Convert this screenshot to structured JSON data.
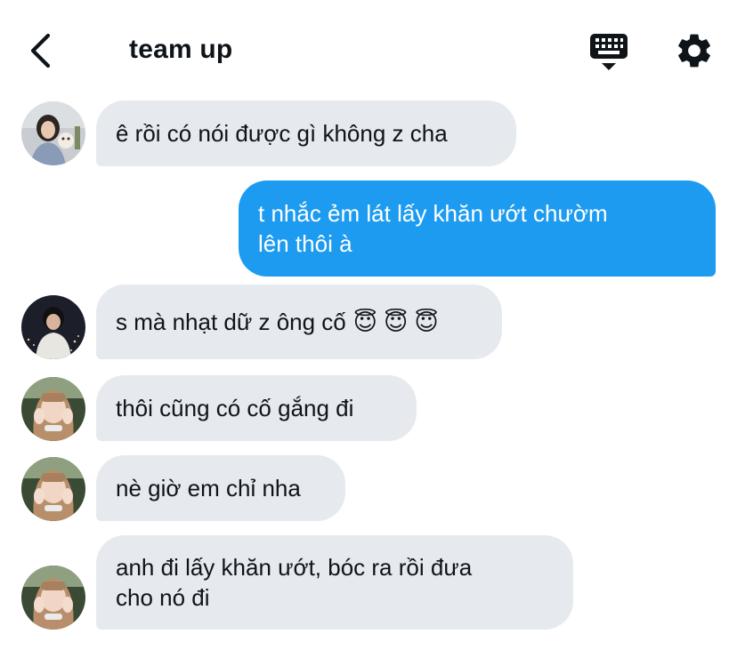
{
  "header": {
    "title": "team up",
    "back_icon": "chevron-left-icon",
    "keyboard_icon": "keyboard-icon",
    "settings_icon": "gear-icon"
  },
  "messages": [
    {
      "direction": "incoming",
      "avatar": "avatar-girl-with-dog",
      "text": "ê rồi có nói được gì không z cha"
    },
    {
      "direction": "outgoing",
      "text_line1": "t nhắc ẻm lát lấy khăn ướt chườm",
      "text_line2": "lên thôi à"
    },
    {
      "direction": "incoming",
      "avatar": "avatar-boy-night-city",
      "text": "s mà nhạt dữ z ông cố",
      "emoji": "😇 😇 😇"
    },
    {
      "direction": "incoming",
      "avatar": "avatar-girl-hands-face",
      "text": "thôi cũng có cố gắng đi"
    },
    {
      "direction": "incoming",
      "avatar": "avatar-girl-hands-face",
      "text": "nè giờ em chỉ nha"
    },
    {
      "direction": "incoming",
      "avatar": "avatar-girl-hands-face",
      "text_line1": "anh đi lấy khăn ướt, bóc ra rồi đưa",
      "text_line2": "cho nó đi"
    }
  ],
  "colors": {
    "incoming_bubble": "#e6e9ee",
    "outgoing_bubble": "#1d9bf0",
    "text": "#0f1419"
  }
}
